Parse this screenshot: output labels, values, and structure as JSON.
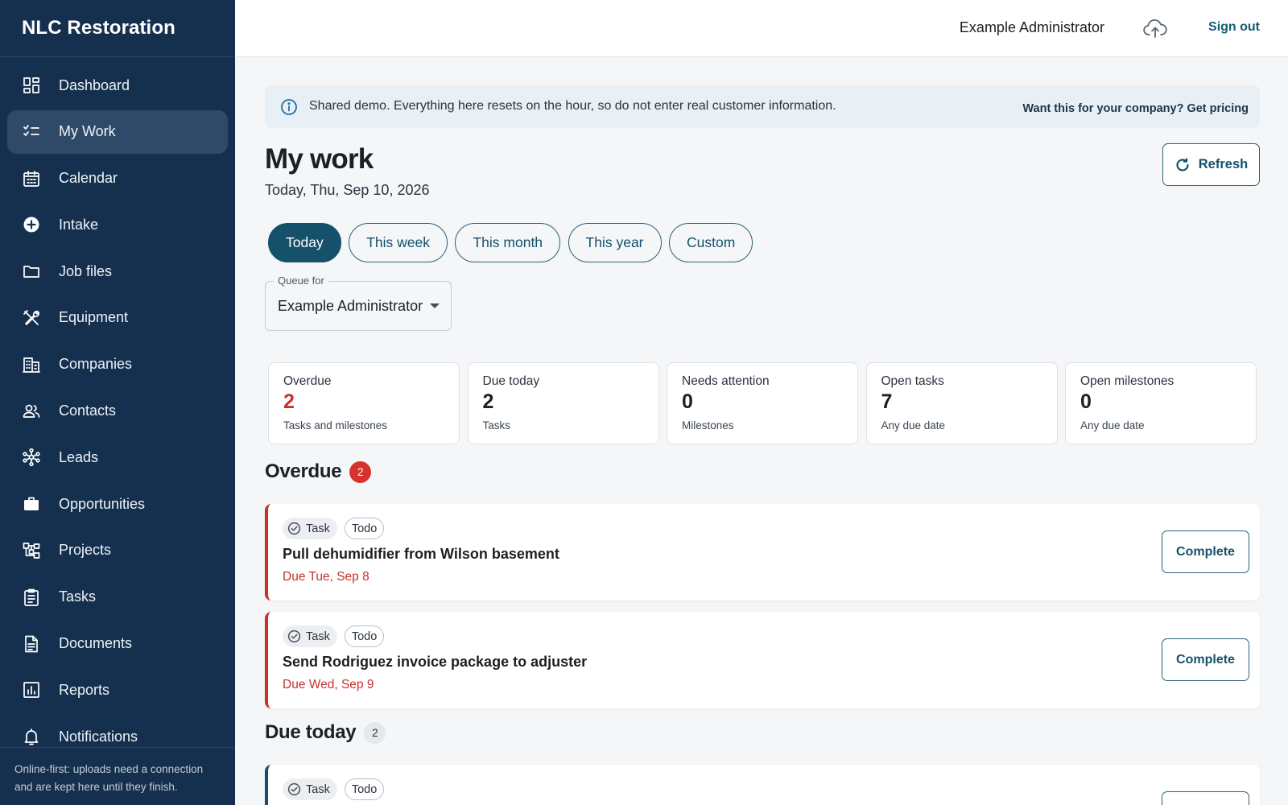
{
  "app": {
    "brand": "NLC Restoration"
  },
  "sidebar": {
    "items": [
      {
        "label": "Dashboard",
        "icon": "dashboard-icon"
      },
      {
        "label": "My Work",
        "icon": "checklist-icon",
        "active": true
      },
      {
        "label": "Calendar",
        "icon": "calendar-icon"
      },
      {
        "label": "Intake",
        "icon": "plus-circle-icon"
      },
      {
        "label": "Job files",
        "icon": "folder-icon"
      },
      {
        "label": "Equipment",
        "icon": "tools-icon"
      },
      {
        "label": "Companies",
        "icon": "building-icon"
      },
      {
        "label": "Contacts",
        "icon": "people-icon"
      },
      {
        "label": "Leads",
        "icon": "network-icon"
      },
      {
        "label": "Opportunities",
        "icon": "briefcase-icon"
      },
      {
        "label": "Projects",
        "icon": "hierarchy-icon"
      },
      {
        "label": "Tasks",
        "icon": "clipboard-icon"
      },
      {
        "label": "Documents",
        "icon": "document-icon"
      },
      {
        "label": "Reports",
        "icon": "chart-icon"
      },
      {
        "label": "Notifications",
        "icon": "bell-icon"
      }
    ],
    "footer": "Online-first: uploads need a connection and are kept here until they finish."
  },
  "topbar": {
    "user": "Example Administrator",
    "sync_icon": "cloud-upload-icon",
    "signout": "Sign out"
  },
  "banner": {
    "text": "Shared demo. Everything here resets on the hour, so do not enter real customer information.",
    "link": "Want this for your company? Get pricing"
  },
  "page": {
    "title": "My work",
    "date": "Today, Thu, Sep 10, 2026",
    "refresh": "Refresh",
    "periods": [
      "Today",
      "This week",
      "This month",
      "This year",
      "Custom"
    ],
    "active_period": "Today",
    "queue": {
      "label": "Queue for",
      "value": "Example Administrator"
    }
  },
  "stats": [
    {
      "label": "Overdue",
      "value": "2",
      "sub": "Tasks and milestones",
      "color": "#c9302c"
    },
    {
      "label": "Due today",
      "value": "2",
      "sub": "Tasks"
    },
    {
      "label": "Needs attention",
      "value": "0",
      "sub": "Milestones"
    },
    {
      "label": "Open tasks",
      "value": "7",
      "sub": "Any due date"
    },
    {
      "label": "Open milestones",
      "value": "0",
      "sub": "Any due date"
    }
  ],
  "sections": {
    "overdue": {
      "title": "Overdue",
      "count": "2",
      "items": [
        {
          "type": "Task",
          "status": "Todo",
          "title": "Pull dehumidifier from Wilson basement",
          "due": "Due Tue, Sep 8",
          "action": "Complete"
        },
        {
          "type": "Task",
          "status": "Todo",
          "title": "Send Rodriguez invoice package to adjuster",
          "due": "Due Wed, Sep 9",
          "action": "Complete"
        }
      ]
    },
    "due_today": {
      "title": "Due today",
      "count": "2",
      "items": [
        {
          "type": "Task",
          "status": "Todo"
        }
      ]
    }
  },
  "colors": {
    "sidebar": "#15304f",
    "accent": "#15516a",
    "danger": "#c9302c"
  }
}
